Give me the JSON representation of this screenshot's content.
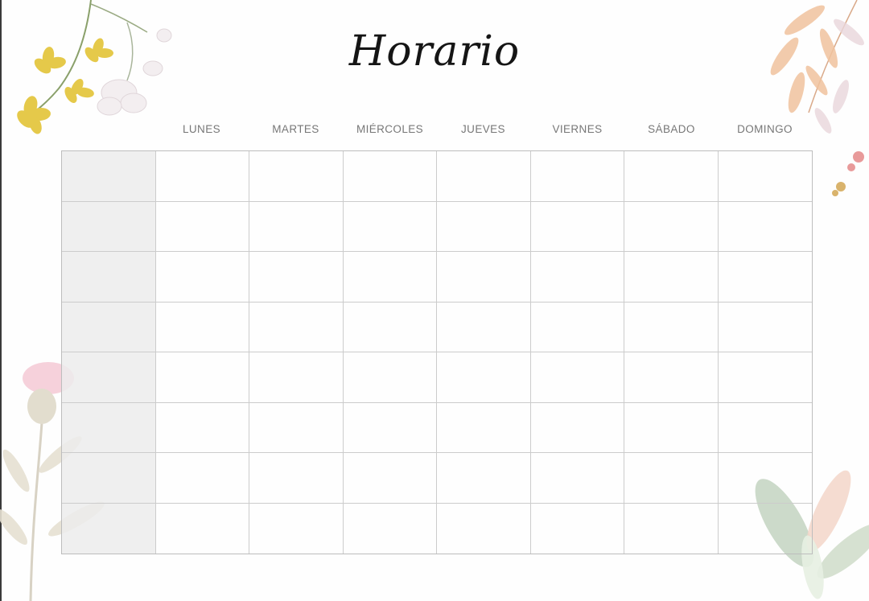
{
  "title": "Horario",
  "days": [
    "LUNES",
    "MARTES",
    "MIÉRCOLES",
    "JUEVES",
    "VIERNES",
    "SÁBADO",
    "DOMINGO"
  ],
  "grid": {
    "rows": 8,
    "columns": 8,
    "time_column_color": "#ececec",
    "line_color": "#cccccc"
  },
  "decorations": {
    "top_left": "yellow-white-flowers-illustration",
    "top_right": "peach-leaves-illustration",
    "bottom_left": "pink-thistle-illustration",
    "bottom_right": "green-leaves-illustration"
  }
}
